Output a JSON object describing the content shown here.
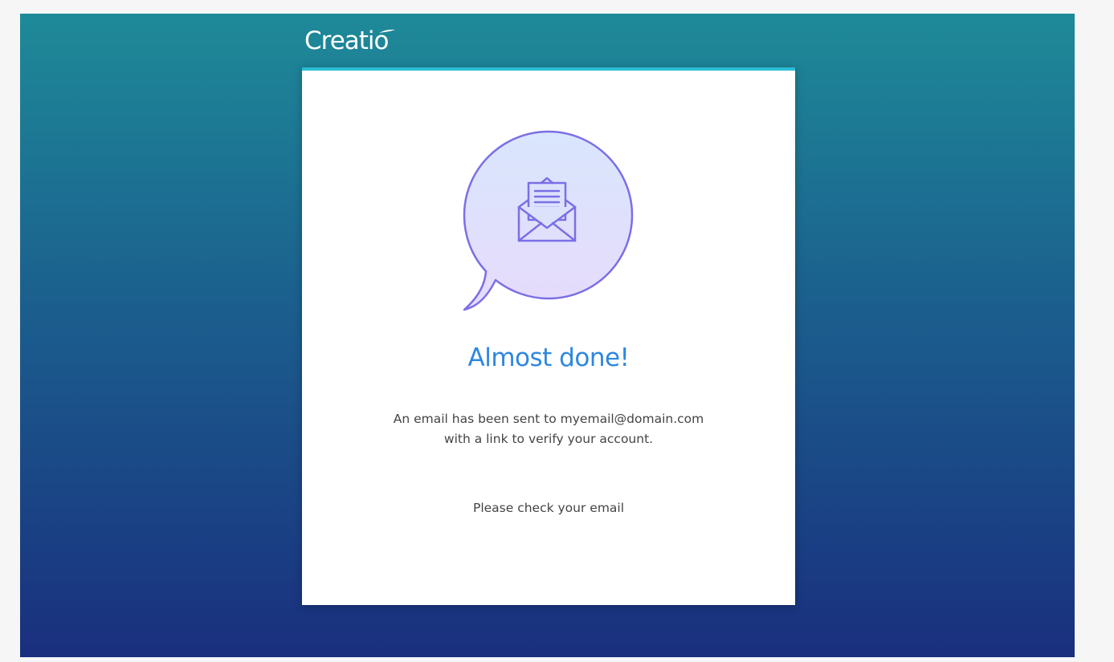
{
  "brand": {
    "logo_text": "Creatio"
  },
  "card": {
    "title": "Almost done!",
    "message": "An email has been sent to myemail@domain.com with a link to verify your account.",
    "instruction": "Please check your email",
    "illustration_icon": "email-envelope-icon"
  },
  "colors": {
    "background_top": "#1e8a98",
    "background_bottom": "#1a2f7e",
    "card_accent": "#2bbcd4",
    "title": "#2e87e0",
    "bubble_stroke": "#7b6fe6"
  }
}
